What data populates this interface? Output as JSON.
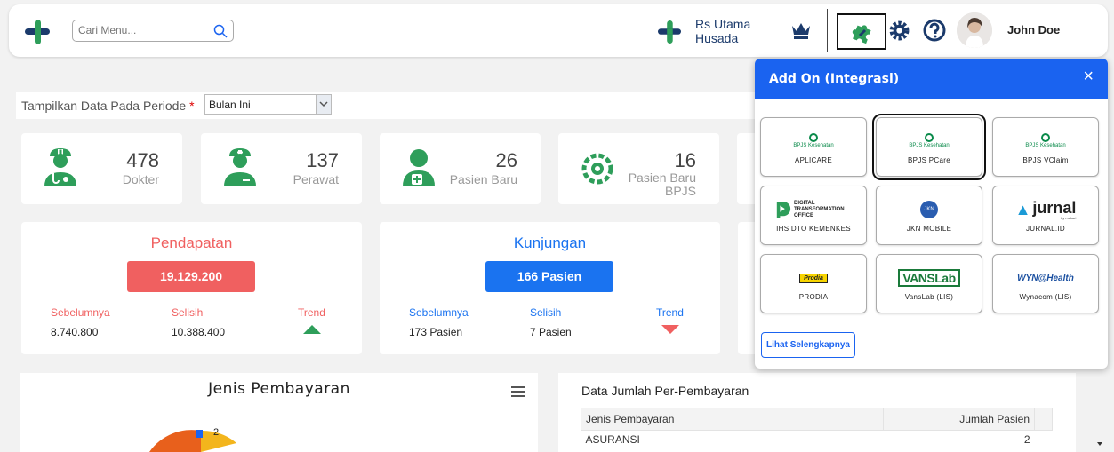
{
  "header": {
    "search_placeholder": "Cari Menu...",
    "hospital_name": "Rs Utama Husada",
    "user_name": "John Doe"
  },
  "period": {
    "label": "Tampilkan Data Pada Periode",
    "required_mark": "*",
    "selected": "Bulan Ini"
  },
  "stats": [
    {
      "value": "478",
      "label": "Dokter"
    },
    {
      "value": "137",
      "label": "Perawat"
    },
    {
      "value": "26",
      "label": "Pasien Baru"
    },
    {
      "value": "16",
      "label": "Pasien Baru BPJS"
    }
  ],
  "pendapatan": {
    "title": "Pendapatan",
    "value": "19.129.200",
    "prev_label": "Sebelumnya",
    "prev_value": "8.740.800",
    "diff_label": "Selisih",
    "diff_value": "10.388.400",
    "trend_label": "Trend",
    "trend": "up",
    "color": "#f06060"
  },
  "kunjungan": {
    "title": "Kunjungan",
    "value": "166 Pasien",
    "prev_label": "Sebelumnya",
    "prev_value": "173 Pasien",
    "diff_label": "Selisih",
    "diff_value": "7 Pasien",
    "trend_label": "Trend",
    "trend": "down",
    "color": "#1a73f0"
  },
  "payment_chart": {
    "title": "Jenis Pembayaran",
    "visible_label": "2"
  },
  "payment_table": {
    "title": "Data Jumlah Per-Pembayaran",
    "columns": [
      "Jenis Pembayaran",
      "Jumlah Pasien"
    ],
    "rows": [
      [
        "ASURANSI",
        "2"
      ]
    ]
  },
  "addon_popup": {
    "title": "Add On (Integrasi)",
    "close_icon": "×",
    "items": [
      {
        "name": "APLICARE",
        "logo": "BPJS Kesehatan"
      },
      {
        "name": "BPJS PCare",
        "logo": "BPJS Kesehatan"
      },
      {
        "name": "BPJS VClaim",
        "logo": "BPJS Kesehatan"
      },
      {
        "name": "IHS DTO KEMENKES",
        "logo": "DIGITAL TRANSFORMATION OFFICE"
      },
      {
        "name": "JKN MOBILE",
        "logo": "JKN"
      },
      {
        "name": "JURNAL.ID",
        "logo": "jurnal",
        "logo_sub": "by mekari"
      },
      {
        "name": "PRODIA",
        "logo": "Prodia"
      },
      {
        "name": "VansLab (LIS)",
        "logo": "VANSLab"
      },
      {
        "name": "Wynacom (LIS)",
        "logo": "WYN@Health"
      }
    ],
    "more_button": "Lihat Selengkapnya"
  },
  "colors": {
    "primary": "#1a63f0",
    "green": "#2e9e5a",
    "navy": "#1b3a6b"
  },
  "icons": [
    "logo-icon",
    "search-icon",
    "crown-icon",
    "puzzle-icon",
    "gear-icon",
    "help-icon",
    "doctor-icon",
    "nurse-icon",
    "patient-icon",
    "bpjs-icon",
    "menu-icon"
  ]
}
